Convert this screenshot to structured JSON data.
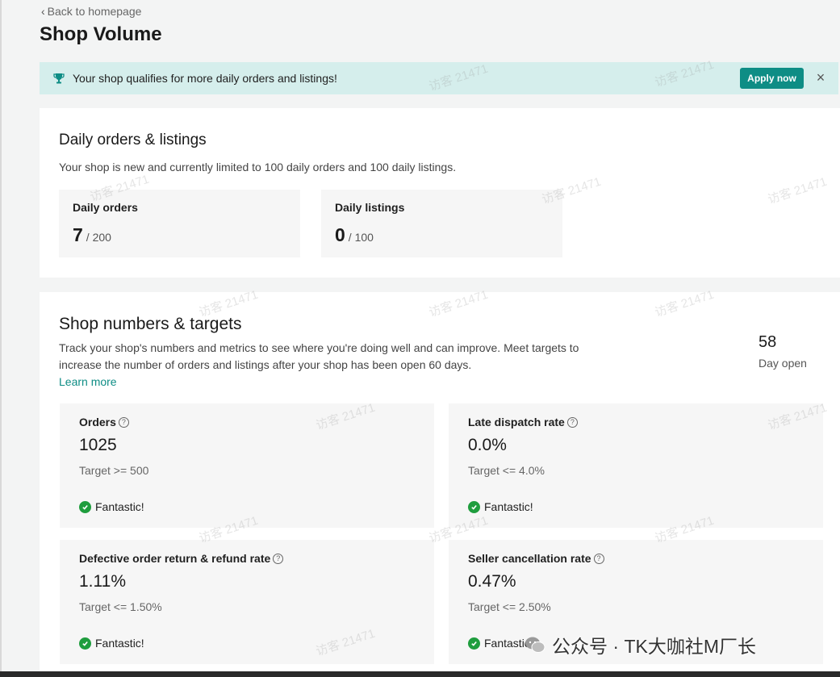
{
  "header": {
    "back_label": "Back to homepage",
    "title": "Shop Volume"
  },
  "banner": {
    "message": "Your shop qualifies for more daily orders and listings!",
    "apply_label": "Apply now",
    "close_glyph": "×",
    "icon": "trophy-icon"
  },
  "daily": {
    "title": "Daily orders & listings",
    "description": "Your shop is new and currently limited to 100 daily orders and 100 daily listings.",
    "orders": {
      "label": "Daily orders",
      "value": "7",
      "limit": "/ 200"
    },
    "listings": {
      "label": "Daily listings",
      "value": "0",
      "limit": "/ 100"
    }
  },
  "targets": {
    "title": "Shop numbers & targets",
    "description": "Track your shop's numbers and metrics to see where you're doing well and can improve. Meet targets to increase the number of orders and listings after your shop has been open 60 days.",
    "learn_more": "Learn more",
    "days_open_value": "58",
    "days_open_label": "Day open",
    "metrics": [
      {
        "title": "Orders",
        "value": "1025",
        "target": "Target >= 500",
        "status": "Fantastic!"
      },
      {
        "title": "Late dispatch rate",
        "value": "0.0%",
        "target": "Target <= 4.0%",
        "status": "Fantastic!"
      },
      {
        "title": "Defective order return & refund rate",
        "value": "1.11%",
        "target": "Target <= 1.50%",
        "status": "Fantastic!"
      },
      {
        "title": "Seller cancellation rate",
        "value": "0.47%",
        "target": "Target <= 2.50%",
        "status": "Fantastic!"
      }
    ]
  },
  "watermark": {
    "text": "访客 21471",
    "footer_text": "公众号 · TK大咖社M厂长"
  },
  "colors": {
    "accent": "#0e8d85",
    "banner_bg": "#d5eeec",
    "success": "#1f9d3e"
  }
}
